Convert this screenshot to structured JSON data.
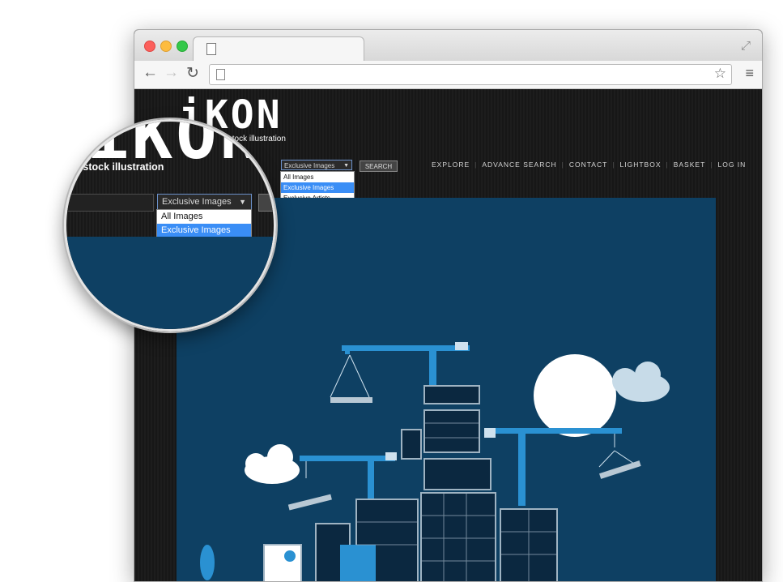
{
  "browser": {
    "tab_title": "",
    "address": ""
  },
  "site": {
    "logo_text": "iKON",
    "tagline_fragment": "s stock illustration",
    "search": {
      "selected_option": "Exclusive Images",
      "options": [
        "All Images",
        "Exclusive Images",
        "Exclusive Artists"
      ],
      "button_label": "SEARCH"
    },
    "nav": [
      "EXPLORE",
      "ADVANCE SEARCH",
      "CONTACT",
      "LIGHTBOX",
      "BASKET",
      "LOG IN"
    ]
  },
  "colors": {
    "page_background": "#1a1a1a",
    "hero_background": "#0e4063",
    "dropdown_highlight": "#3a8ef6",
    "crane": "#2a91d2"
  },
  "icons": [
    "back-arrow-icon",
    "forward-arrow-icon",
    "reload-icon",
    "page-icon",
    "star-icon",
    "menu-icon",
    "fullscreen-icon"
  ]
}
